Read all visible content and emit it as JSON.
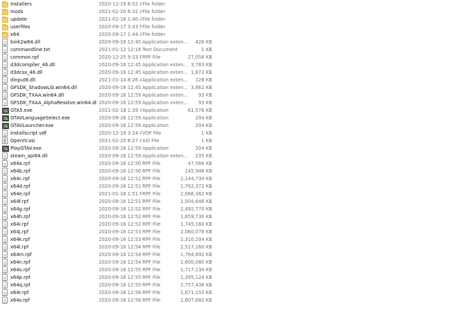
{
  "colors": {
    "folder": "#f6d26a",
    "folder_border": "#d9b24d",
    "text": "#111111",
    "meta_text": "#6d6d6d",
    "background": "#ffffff"
  },
  "files": [
    {
      "name": "Installers",
      "date": "2020-12-19 6:02 AM",
      "type": "File folder",
      "size": "",
      "icon": "folder-icon"
    },
    {
      "name": "mods",
      "date": "2021-02-20 6:32 AM",
      "type": "File folder",
      "size": "",
      "icon": "folder-icon"
    },
    {
      "name": "update",
      "date": "2021-02-18 1:40 AM",
      "type": "File folder",
      "size": "",
      "icon": "folder-icon"
    },
    {
      "name": "userfiles",
      "date": "2020-09-17 3:43 PM",
      "type": "File folder",
      "size": "",
      "icon": "folder-icon"
    },
    {
      "name": "x64",
      "date": "2020-09-17 1:44 AM",
      "type": "File folder",
      "size": "",
      "icon": "folder-icon"
    },
    {
      "name": "bink2w64.dll",
      "date": "2020-09-16 12:45 ...",
      "type": "Application exten...",
      "size": "426 KB",
      "icon": "document-icon"
    },
    {
      "name": "commandline.txt",
      "date": "2021-01-12 12:16 ...",
      "type": "Text Document",
      "size": "1 KB",
      "icon": "document-icon"
    },
    {
      "name": "common.rpf",
      "date": "2020-12-25 9:33 PM",
      "type": "RPF File",
      "size": "27,056 KB",
      "icon": "document-icon"
    },
    {
      "name": "d3dcompiler_46.dll",
      "date": "2020-09-16 12:45 ...",
      "type": "Application exten...",
      "size": "3,783 KB",
      "icon": "document-icon"
    },
    {
      "name": "d3dcsx_46.dll",
      "date": "2020-09-16 12:45 ...",
      "type": "Application exten...",
      "size": "1,872 KB",
      "icon": "document-icon"
    },
    {
      "name": "dinput8.dll",
      "date": "2021-01-14 8:26 AM",
      "type": "Application exten...",
      "size": "128 KB",
      "icon": "document-icon"
    },
    {
      "name": "GFSDK_ShadowLib.win64.dll",
      "date": "2020-09-16 12:45 ...",
      "type": "Application exten...",
      "size": "3,862 KB",
      "icon": "document-icon"
    },
    {
      "name": "GFSDK_TXAA.win64.dll",
      "date": "2020-09-16 12:59 ...",
      "type": "Application exten...",
      "size": "93 KB",
      "icon": "document-icon"
    },
    {
      "name": "GFSDK_TXAA_AlphaResolve.win64.dll",
      "date": "2020-09-16 12:59 ...",
      "type": "Application exten...",
      "size": "93 KB",
      "icon": "document-icon"
    },
    {
      "name": "GTA5.exe",
      "date": "2021-02-18 1:39 AM",
      "type": "Application",
      "size": "61,576 KB",
      "icon": "application-icon"
    },
    {
      "name": "GTAVLanguageSelect.exe",
      "date": "2020-09-16 12:59 ...",
      "type": "Application",
      "size": "204 KB",
      "icon": "application-icon"
    },
    {
      "name": "GTAVLauncher.exe",
      "date": "2020-09-16 12:59 ...",
      "type": "Application",
      "size": "204 KB",
      "icon": "application-icon"
    },
    {
      "name": "installscript.vdf",
      "date": "2020-12-19 3:24 AM",
      "type": "VDF File",
      "size": "1 KB",
      "icon": "document-icon"
    },
    {
      "name": "OpenIV.asi",
      "date": "2021-02-20 6:27 AM",
      "type": "ASI File",
      "size": "1 KB",
      "icon": "setup-icon"
    },
    {
      "name": "PlayGTAV.exe",
      "date": "2020-09-16 12:59 ...",
      "type": "Application",
      "size": "204 KB",
      "icon": "application-icon"
    },
    {
      "name": "steam_api64.dll",
      "date": "2020-09-16 12:59 ...",
      "type": "Application exten...",
      "size": "235 KB",
      "icon": "document-icon"
    },
    {
      "name": "x64a.rpf",
      "date": "2020-09-16 12:50 ...",
      "type": "RPF File",
      "size": "47,566 KB",
      "icon": "document-icon"
    },
    {
      "name": "x64b.rpf",
      "date": "2020-09-16 12:50 ...",
      "type": "RPF File",
      "size": "145,946 KB",
      "icon": "document-icon"
    },
    {
      "name": "x64c.rpf",
      "date": "2020-09-16 12:51 ...",
      "type": "RPF File",
      "size": "2,144,734 KB",
      "icon": "document-icon"
    },
    {
      "name": "x64d.rpf",
      "date": "2020-09-16 12:51 ...",
      "type": "RPF File",
      "size": "1,762,372 KB",
      "icon": "document-icon"
    },
    {
      "name": "x64e.rpf",
      "date": "2021-01-16 1:51 PM",
      "type": "RPF File",
      "size": "2,066,362 KB",
      "icon": "document-icon"
    },
    {
      "name": "x64f.rpf",
      "date": "2020-09-16 12:51 ...",
      "type": "RPF File",
      "size": "1,004,646 KB",
      "icon": "document-icon"
    },
    {
      "name": "x64g.rpf",
      "date": "2020-09-16 12:52 ...",
      "type": "RPF File",
      "size": "2,492,770 KB",
      "icon": "document-icon"
    },
    {
      "name": "x64h.rpf",
      "date": "2020-09-16 12:52 ...",
      "type": "RPF File",
      "size": "1,659,730 KB",
      "icon": "document-icon"
    },
    {
      "name": "x64i.rpf",
      "date": "2020-09-16 12:52 ...",
      "type": "RPF File",
      "size": "1,745,160 KB",
      "icon": "document-icon"
    },
    {
      "name": "x64j.rpf",
      "date": "2020-09-16 12:53 ...",
      "type": "RPF File",
      "size": "2,060,078 KB",
      "icon": "document-icon"
    },
    {
      "name": "x64k.rpf",
      "date": "2020-09-16 12:53 ...",
      "type": "RPF File",
      "size": "2,310,204 KB",
      "icon": "document-icon"
    },
    {
      "name": "x64l.rpf",
      "date": "2020-09-16 12:54 ...",
      "type": "RPF File",
      "size": "2,517,160 KB",
      "icon": "document-icon"
    },
    {
      "name": "x64m.rpf",
      "date": "2020-09-16 12:54 ...",
      "type": "RPF File",
      "size": "1,764,892 KB",
      "icon": "document-icon"
    },
    {
      "name": "x64n.rpf",
      "date": "2020-09-16 12:54 ...",
      "type": "RPF File",
      "size": "1,600,080 KB",
      "icon": "document-icon"
    },
    {
      "name": "x64o.rpf",
      "date": "2020-09-16 12:55 ...",
      "type": "RPF File",
      "size": "1,717,134 KB",
      "icon": "document-icon"
    },
    {
      "name": "x64p.rpf",
      "date": "2020-09-16 12:55 ...",
      "type": "RPF File",
      "size": "1,395,124 KB",
      "icon": "document-icon"
    },
    {
      "name": "x64q.rpf",
      "date": "2020-09-16 12:55 ...",
      "type": "RPF File",
      "size": "2,757,436 KB",
      "icon": "document-icon"
    },
    {
      "name": "x64r.rpf",
      "date": "2020-09-16 12:56 ...",
      "type": "RPF File",
      "size": "1,671,152 KB",
      "icon": "document-icon"
    },
    {
      "name": "x64s.rpf",
      "date": "2020-09-16 12:56 ...",
      "type": "RPF File",
      "size": "1,607,682 KB",
      "icon": "document-icon"
    }
  ]
}
